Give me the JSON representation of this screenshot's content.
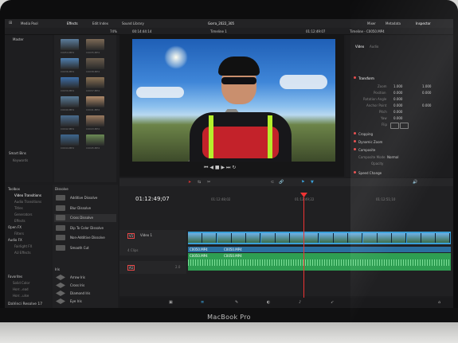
{
  "menubar": {
    "media_pool": "Media Pool",
    "effects": "Effects",
    "edit_index": "Edit Index",
    "sound_library": "Sound Library",
    "project_title": "Gorra_2022_305",
    "mixer": "Mixer",
    "metadata": "Metadata",
    "inspector": "Inspector"
  },
  "subbar": {
    "zoom": "74%",
    "timecode_left": "00:14:44:14",
    "timeline_name": "Timeline 1",
    "timecode_right": "01:12:49:07",
    "inspector_title": "Timeline - C0050.MP4"
  },
  "media_pool": {
    "bin": "Master",
    "smart_bins": "Smart Bins",
    "keywords": "Keywords",
    "clips": [
      {
        "name": "C0054.MP4",
        "color": "#5b7d9c"
      },
      {
        "name": "C0035.MP4",
        "color": "#7c6a56"
      },
      {
        "name": "C0036.MP4",
        "color": "#4f7fb0"
      },
      {
        "name": "C0038.MP4",
        "color": "#6a5c4d"
      },
      {
        "name": "C0039.MP4",
        "color": "#3d6ea8"
      },
      {
        "name": "C0037.MP4",
        "color": "#8a7254"
      },
      {
        "name": "C0040.MP4",
        "color": "#597c99"
      },
      {
        "name": "C0041.MP4",
        "color": "#b08a6a"
      },
      {
        "name": "C0042.MP4",
        "color": "#4a6c8e"
      },
      {
        "name": "C0043.MP4",
        "color": "#9a7a60"
      },
      {
        "name": "C0044.MP4",
        "color": "#3e678f"
      },
      {
        "name": "C0045.MP4",
        "color": "#6b8a54"
      }
    ]
  },
  "effects": {
    "toolbox": "Toolbox",
    "video_transitions": "Video Transitions",
    "audio_transitions": "Audio Transitions",
    "titles": "Titles",
    "generators": "Generators",
    "effects_item": "Effects",
    "open_fx": "Open FX",
    "filters": "Filters",
    "audio_fx": "Audio FX",
    "fairlight_fx": "Fairlight FX",
    "au_effects": "AU Effects",
    "favorites": "Favorites",
    "fav1": "Solid Color",
    "fav2": "Horr...ead",
    "fav3": "Horr...ulse",
    "dissolve_header": "Dissolve",
    "dissolve": [
      "Additive Dissolve",
      "Blur Dissolve",
      "Cross Dissolve",
      "Dip To Color Dissolve",
      "Non-Additive Dissolve",
      "Smooth Cut"
    ],
    "iris_header": "Iris",
    "iris": [
      "Arrow Iris",
      "Cross Iris",
      "Diamond Iris",
      "Eye Iris"
    ]
  },
  "inspector": {
    "tab_video": "Video",
    "tab_audio": "Audio",
    "transform": "Transform",
    "zoom": "Zoom",
    "position": "Position",
    "rotation": "Rotation Angle",
    "anchor": "Anchor Point",
    "pitch": "Pitch",
    "yaw": "Yaw",
    "flip": "Flip",
    "zoom_x": "1.000",
    "zoom_y": "1.000",
    "pos_x": "0.000",
    "pos_y": "0.000",
    "rot": "0.000",
    "anc_x": "0.000",
    "anc_y": "0.000",
    "pitch_v": "0.000",
    "yaw_v": "0.000",
    "cropping": "Cropping",
    "dynamic_zoom": "Dynamic Zoom",
    "composite": "Composite",
    "composite_mode": "Composite Mode",
    "composite_mode_v": "Normal",
    "opacity": "Opacity",
    "speed_change": "Speed Change"
  },
  "timeline": {
    "timecode": "01:12:49;07",
    "ruler": [
      "01:12:48;02",
      "01:12:49;22",
      "01:12:51;10"
    ],
    "v1_tag": "V1",
    "video1": "Video 1",
    "v1_clips": "4 Clips",
    "a1_tag": "A1",
    "a1_vol": "2.0",
    "clip_a": "C0050.MP4",
    "clip_b": "C0050.MP4"
  },
  "app": {
    "name": "DaVinci Resolve 17"
  },
  "laptop": {
    "brand": "MacBook Pro"
  }
}
